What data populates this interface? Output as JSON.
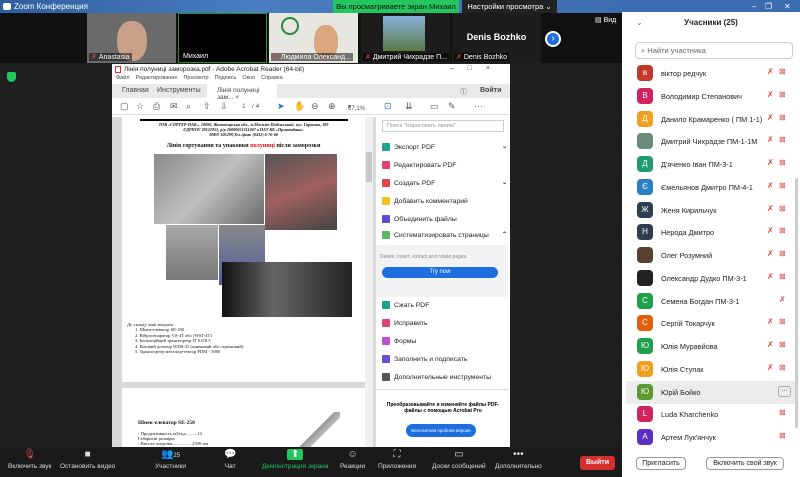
{
  "window": {
    "title": "Zoom Конференция",
    "banner": "Вы просматриваете экран Михаил",
    "view_settings": "Настройки просмотра ⌄",
    "view_button": "Вид"
  },
  "gallery": [
    {
      "name": "Anastasia"
    },
    {
      "name": "Михаил"
    },
    {
      "name": "Людмила Олександ..."
    },
    {
      "name": "Дмитрий Чихрадзе П..."
    },
    {
      "name": "Denis Bozhko",
      "title": "Denis Bozhko"
    }
  ],
  "acrobat": {
    "title": "Лінія полуниці заморозка.pdf - Adobe Acrobat Reader (64-bit)",
    "menu": [
      "Файл",
      "Редактирование",
      "Просмотр",
      "Подпись",
      "Окно",
      "Справка"
    ],
    "tabs": {
      "home": "Главная",
      "tools": "Инструменты",
      "doc": "Лінія полуниці зам...  ×",
      "signin": "Войти"
    },
    "page": "1",
    "pages": "/ 4",
    "zoom": "67,1%",
    "search_placeholder": "Поиск \"Нарисовать линию\"",
    "tools": [
      {
        "label": "Экспорт PDF",
        "color": "#1fa38a"
      },
      {
        "label": "Редактировать PDF",
        "color": "#e0437c"
      },
      {
        "label": "Создать PDF",
        "color": "#e0434b"
      },
      {
        "label": "Добавить комментарий",
        "color": "#f0c020"
      },
      {
        "label": "Объединить файлы",
        "color": "#5b4fd6"
      },
      {
        "label": "Систематизировать страницы",
        "color": "#5cb85c"
      }
    ],
    "tools2": [
      {
        "label": "Сжать PDF",
        "color": "#1fa38a"
      },
      {
        "label": "Исправить",
        "color": "#e0437c"
      },
      {
        "label": "Формы",
        "color": "#c04fd6"
      },
      {
        "label": "Заполнить и подписать",
        "color": "#6a4fd6"
      },
      {
        "label": "Дополнительные инструменты",
        "color": "#555"
      }
    ],
    "promo_text": "Delete, insert, extract and rotate pages.",
    "try_now": "Try now",
    "pro_text": "Преобразовывайте и изменяйте файлы PDF-файлы с помощью Acrobat Pro",
    "trial": "Бесплатная пробная версия",
    "doc": {
      "header1": "ТОВ «СОРТЕР-ПАК», 10000, Житомирська обл., м.Могилів-Подільський, вул. Гаранта, 189",
      "header2": "ЄДРПОУ 39121955, р/р 26000051311007 в ПАТ КБ «Приватбанк»",
      "header3": "МФО 305299,Тел./факс (0432) 6-76-60",
      "title_a": "Лінія сортування та упаковки ",
      "title_b": "полуниці",
      "title_c": " після заморозки",
      "list_intro": "До складу лінії входить:",
      "list": [
        "Шнек-елеватор SE-250",
        "Вібросепаратор VS-4T або (WST-4T)",
        "Інспекційний транспортер IT 6.0/0.5",
        "Ваговий дозатор WDS-25 (шнековий або стрічковий)",
        "Транспортер металодетектор PDM - 3000"
      ],
      "section2": "Шнек-елеватор SE-250",
      "spec1": "- Продуктивність м3/год..........14",
      "spec2": "Габаритні розміри:",
      "spec3": "- Висота загрузки.................2500 мм"
    }
  },
  "participants": {
    "header": "Учасники (25)",
    "search_placeholder": "Найти участника",
    "list": [
      {
        "initial": "в",
        "name": "віктор редчук",
        "color": "#c0392b",
        "video": true
      },
      {
        "initial": "В",
        "name": "Володимир Степанович",
        "color": "#d0245e",
        "video": true
      },
      {
        "initial": "Д",
        "name": "Данило Крамаренко ( ПМ 1-1)",
        "color": "#f0a020",
        "video": true
      },
      {
        "initial": "",
        "name": "Дмитрий Чихрадзе ПМ-1-1М",
        "color": "#6a8a7a",
        "video": true
      },
      {
        "initial": "Д",
        "name": "Д'яченко Іван ПМ-3-1",
        "color": "#1f9c6b",
        "video": true
      },
      {
        "initial": "Є",
        "name": "Ємельянов Дмитро ПМ-4-1",
        "color": "#2a7fc0",
        "video": true
      },
      {
        "initial": "Ж",
        "name": "Женя Кирильчук",
        "color": "#2c3e50",
        "video": true
      },
      {
        "initial": "Н",
        "name": "Нерода Дмитро",
        "color": "#2c3e50",
        "video": true
      },
      {
        "initial": "",
        "name": "Олег Розумний",
        "color": "#5a4030",
        "video": true
      },
      {
        "initial": "",
        "name": "Олександр Дудко ПМ-3-1",
        "color": "#222",
        "video": true
      },
      {
        "initial": "С",
        "name": "Семена Богдан ПМ-3-1",
        "color": "#20a04a",
        "video": false
      },
      {
        "initial": "С",
        "name": "Сергій Токарчук",
        "color": "#e06010",
        "video": true
      },
      {
        "initial": "Ю",
        "name": "Юлія Муравйова",
        "color": "#20a04a",
        "video": true
      },
      {
        "initial": "Ю",
        "name": "Юлія Ступак",
        "color": "#f0a020",
        "video": true
      },
      {
        "initial": "Ю",
        "name": "Юрій Бойко",
        "color": "#5a9a30",
        "video": false,
        "highlight": true
      },
      {
        "initial": "L",
        "name": "Luda Kharchenko",
        "color": "#d0245e",
        "video": true,
        "nomic": true
      },
      {
        "initial": "А",
        "name": "Артем Лук'янчук",
        "color": "#5b2fc0",
        "video": true,
        "nomic": true
      }
    ],
    "invite": "Пригласить",
    "unmute_self": "Включить свой звук"
  },
  "toolbar": [
    {
      "label": "Включить звук",
      "glyph": "🎙"
    },
    {
      "label": "Остановить видео",
      "glyph": "■"
    },
    {
      "label": "Участники",
      "glyph": "👥",
      "count": "25"
    },
    {
      "label": "Чат",
      "glyph": "💬"
    },
    {
      "label": "Демонстрация экрана",
      "glyph": "⬆"
    },
    {
      "label": "Реакции",
      "glyph": "☺"
    },
    {
      "label": "Приложения",
      "glyph": "⛶"
    },
    {
      "label": "Доски сообщений",
      "glyph": "▭"
    },
    {
      "label": "Дополнительно",
      "glyph": "•••"
    }
  ],
  "leave": "Выйти"
}
